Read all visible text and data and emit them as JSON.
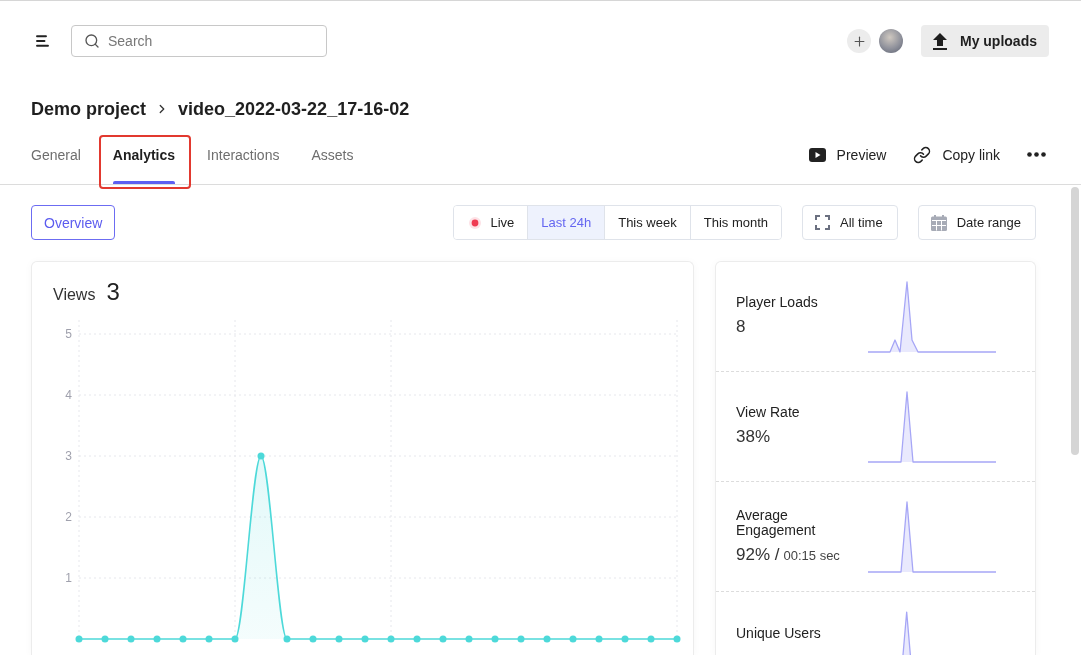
{
  "header": {
    "search": {
      "placeholder": "Search"
    },
    "upload_button": "My uploads"
  },
  "breadcrumb": {
    "project": "Demo project",
    "video": "video_2022-03-22_17-16-02"
  },
  "tabs": [
    {
      "label": "General",
      "selected": false,
      "highlighted": false
    },
    {
      "label": "Analytics",
      "selected": true,
      "highlighted": true
    },
    {
      "label": "Interactions",
      "selected": false,
      "highlighted": false
    },
    {
      "label": "Assets",
      "selected": false,
      "highlighted": false
    }
  ],
  "actions": [
    {
      "kind": "preview",
      "label": "Preview"
    },
    {
      "kind": "copy_link",
      "label": "Copy link"
    },
    {
      "kind": "more"
    }
  ],
  "filters": {
    "overview_button": "Overview",
    "ranges": [
      {
        "kind": "live",
        "label": "Live",
        "selected": false
      },
      {
        "kind": "range",
        "label": "Last 24h",
        "selected": true
      },
      {
        "kind": "range",
        "label": "This week",
        "selected": false
      },
      {
        "kind": "range",
        "label": "This month",
        "selected": false
      }
    ],
    "buttons": [
      {
        "kind": "all_time",
        "label": "All time"
      },
      {
        "kind": "date_range",
        "label": "Date range"
      }
    ]
  },
  "views_card": {
    "count": "3",
    "chart_data": {
      "type": "area",
      "title": "Views",
      "grid": true,
      "ylim": [
        0,
        5
      ],
      "yticks": [
        1,
        2,
        3,
        4,
        5
      ],
      "series": [
        {
          "color": "#4dd9d9",
          "values": [
            0,
            0,
            0,
            0,
            0,
            0,
            0,
            3,
            0,
            0,
            0,
            0,
            0,
            0,
            0,
            0,
            0,
            0,
            0,
            0,
            0,
            0,
            0,
            0
          ]
        }
      ]
    }
  },
  "metrics": [
    {
      "label": "Player Loads",
      "value": "8",
      "kind": "bump"
    },
    {
      "label": "View Rate",
      "value": "38%",
      "kind": "spike"
    },
    {
      "label": "Average Engagement",
      "value": "92% /",
      "detail": "00:15 sec",
      "kind": "spike"
    },
    {
      "label": "Unique Users",
      "kind": "spike"
    }
  ]
}
